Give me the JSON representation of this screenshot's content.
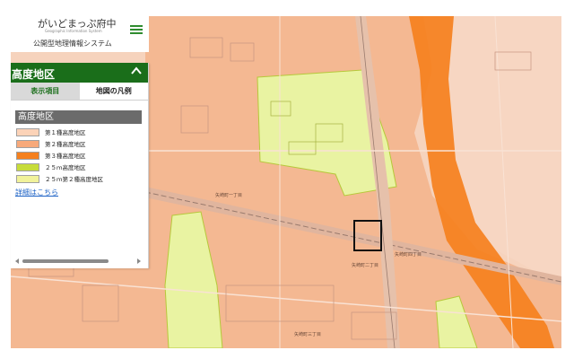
{
  "app": {
    "brand": "がいどまっぷ府中",
    "brand_sub": "Geographic Information System",
    "system_name": "公開型地理情報システム"
  },
  "panel": {
    "title": "高度地区",
    "tabs": [
      {
        "label": "表示項目",
        "active": false
      },
      {
        "label": "地図の凡例",
        "active": true
      }
    ],
    "legend_heading": "高度地区",
    "legend": [
      {
        "label": "第１種高度地区",
        "color": "#fcd3b8"
      },
      {
        "label": "第２種高度地区",
        "color": "#f7a97a"
      },
      {
        "label": "第３種高度地区",
        "color": "#f5801e"
      },
      {
        "label": "２５ｍ高度地区",
        "color": "#c7dc3a"
      },
      {
        "label": "２５ｍ第２種高度地区",
        "color": "#f1f29a"
      }
    ],
    "details_link": "詳細はこちら"
  },
  "map": {
    "labels": {
      "yazakicho_1": "矢崎町一丁目",
      "yazakicho_2": "矢崎町二丁目",
      "yazakicho_3": "矢崎町三丁目",
      "yazakicho_4": "矢崎町四丁目"
    }
  },
  "colors": {
    "header_green": "#1a6e1a",
    "zone_1": "#fcd3b8",
    "zone_2": "#f7a97a",
    "zone_3": "#f5801e",
    "zone_25m": "#c7dc3a",
    "zone_25m_2": "#f1f29a",
    "link_blue": "#1e63c6"
  }
}
